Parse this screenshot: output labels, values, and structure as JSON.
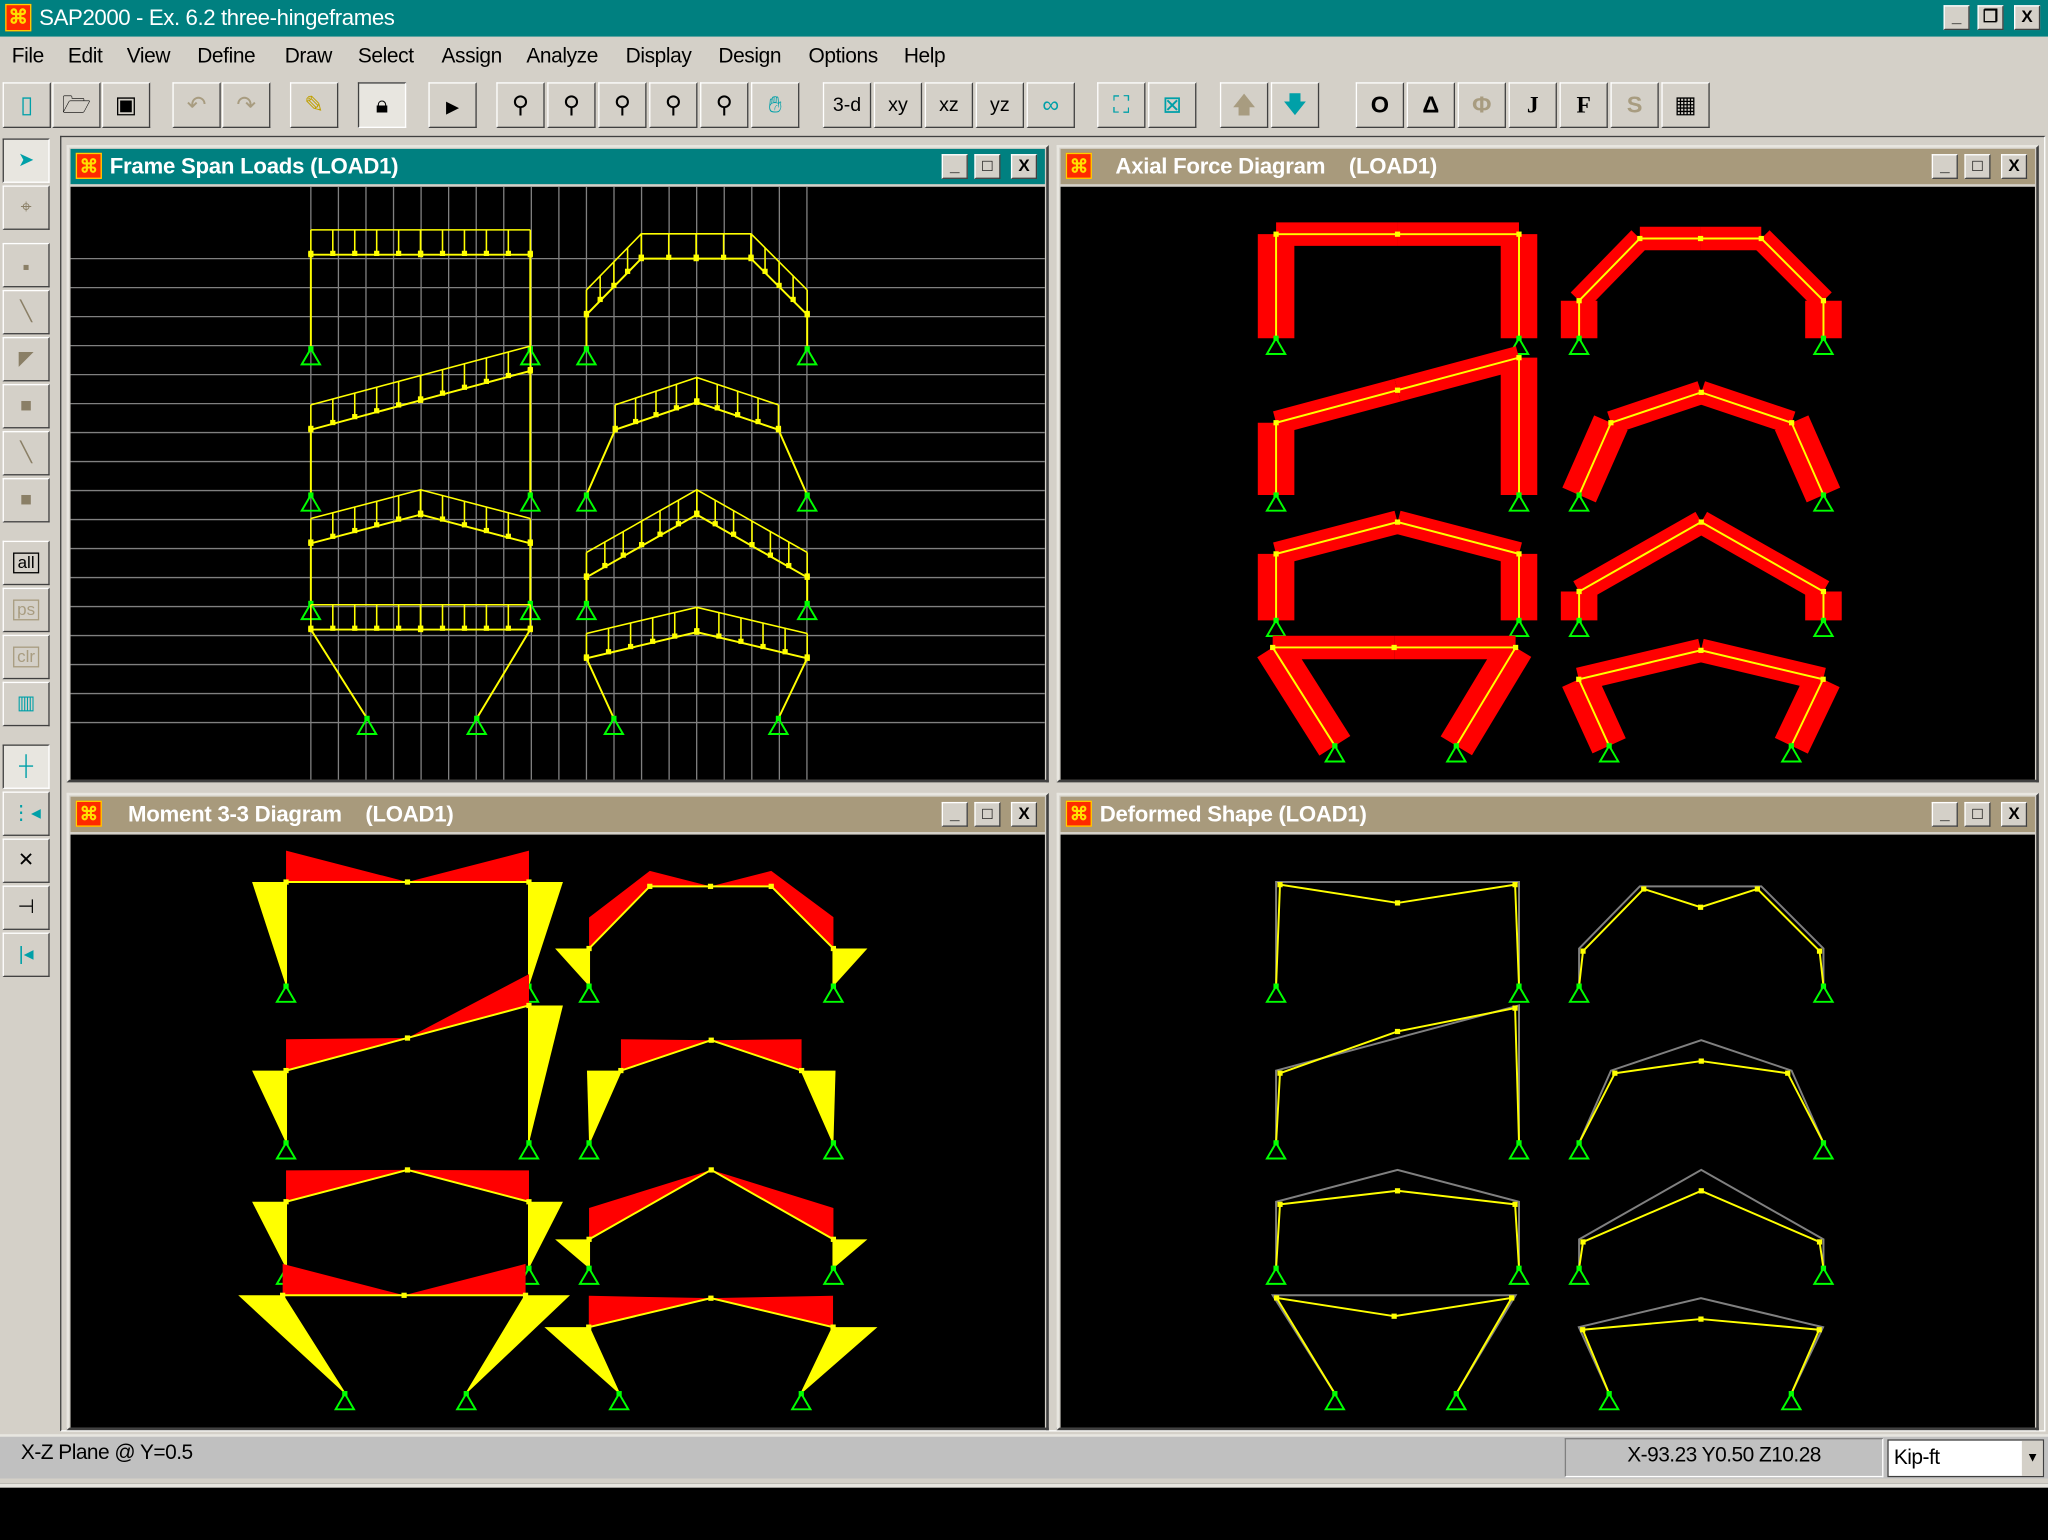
{
  "app": {
    "title": "SAP2000 - Ex. 6.2 three-hingeframes",
    "icon": "sap-logo-icon"
  },
  "window_controls": {
    "minimize": "_",
    "restore": "❐",
    "close": "X"
  },
  "menu": [
    "File",
    "Edit",
    "View",
    "Define",
    "Draw",
    "Select",
    "Assign",
    "Analyze",
    "Display",
    "Design",
    "Options",
    "Help"
  ],
  "toolbar": {
    "view_3d": "3-d",
    "view_xy": "xy",
    "view_xz": "xz",
    "view_yz": "yz",
    "joint_o": "O",
    "delta": "Δ",
    "phi": "Φ",
    "j": "J",
    "f": "F",
    "s": "S"
  },
  "left_toolbar": {
    "all": "all",
    "ps": "ps",
    "clr": "clr"
  },
  "panels": [
    {
      "title": "Frame Span Loads (LOAD1)",
      "active": true
    },
    {
      "title": "Axial Force Diagram    (LOAD1)",
      "active": false
    },
    {
      "title": "Moment 3-3 Diagram    (LOAD1)",
      "active": false
    },
    {
      "title": "Deformed Shape (LOAD1)",
      "active": false
    }
  ],
  "colors": {
    "frame": "#ffff00",
    "support": "#00ff00",
    "axial": "#ff0000",
    "moment_beam": "#ff0000",
    "moment_column": "#ffff00",
    "undeformed": "#808080",
    "grid": "#808080"
  },
  "status": {
    "plane": "X-Z Plane @ Y=0.5",
    "coords": "X-93.23  Y0.50  Z10.28",
    "units": "Kip-ft"
  }
}
